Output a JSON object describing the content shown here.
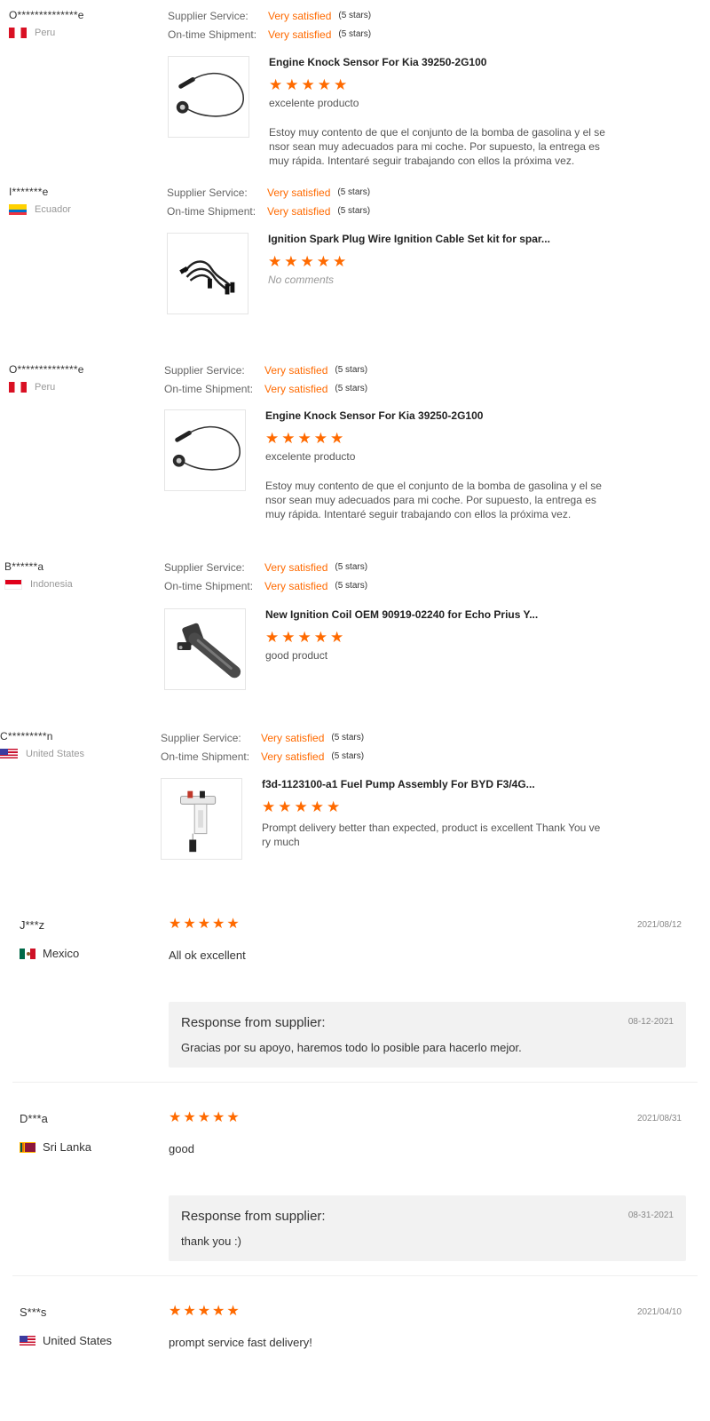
{
  "labels": {
    "supplier_service": "Supplier Service:",
    "ontime_shipment": "On-time Shipment:",
    "response_from_supplier": "Response from supplier:"
  },
  "product_reviews": [
    {
      "user": "O**************e",
      "country": "Peru",
      "supplier_service": "Very satisfied",
      "supplier_service_stars": "(5 stars)",
      "ontime_shipment": "Very satisfied",
      "ontime_shipment_stars": "(5 stars)",
      "product_title": "Engine Knock Sensor For Kia 39250-2G100",
      "product_image": "knock-sensor-image",
      "rating": 5,
      "comment": "excelente producto",
      "detail": "Estoy muy contento de que el conjunto de la bomba de gasolina y el se nsor sean muy adecuados para mi coche. Por supuesto, la entrega es muy rápida. Intentaré seguir trabajando con ellos la próxima vez."
    },
    {
      "user": "I*******e",
      "country": "Ecuador",
      "supplier_service": "Very satisfied",
      "supplier_service_stars": "(5 stars)",
      "ontime_shipment": "Very satisfied",
      "ontime_shipment_stars": "(5 stars)",
      "product_title": "Ignition Spark Plug Wire Ignition Cable Set kit for spar...",
      "product_image": "spark-plug-wire-image",
      "rating": 5,
      "comment": "No comments",
      "detail": ""
    },
    {
      "user": "O**************e",
      "country": "Peru",
      "supplier_service": "Very satisfied",
      "supplier_service_stars": "(5 stars)",
      "ontime_shipment": "Very satisfied",
      "ontime_shipment_stars": "(5 stars)",
      "product_title": "Engine Knock Sensor For Kia 39250-2G100",
      "product_image": "knock-sensor-image",
      "rating": 5,
      "comment": "excelente producto",
      "detail": "Estoy muy contento de que el conjunto de la bomba de gasolina y el se nsor sean muy adecuados para mi coche. Por supuesto, la entrega es muy rápida. Intentaré seguir trabajando con ellos la próxima vez."
    },
    {
      "user": "B******a",
      "country": "Indonesia",
      "supplier_service": "Very satisfied",
      "supplier_service_stars": "(5 stars)",
      "ontime_shipment": "Very satisfied",
      "ontime_shipment_stars": "(5 stars)",
      "product_title": "New Ignition Coil OEM 90919-02240 for Echo Prius Y...",
      "product_image": "ignition-coil-image",
      "rating": 5,
      "comment": "good product",
      "detail": ""
    },
    {
      "user": "C*********n",
      "country": "United States",
      "supplier_service": "Very satisfied",
      "supplier_service_stars": "(5 stars)",
      "ontime_shipment": "Very satisfied",
      "ontime_shipment_stars": "(5 stars)",
      "product_title": "f3d-1123100-a1 Fuel Pump Assembly For BYD F3/4G...",
      "product_image": "fuel-pump-image",
      "rating": 5,
      "comment": "Prompt delivery better than expected, product is excellent Thank You ve ry much",
      "detail": ""
    }
  ],
  "feedback": [
    {
      "user": "J***z",
      "country": "Mexico",
      "rating": 5,
      "date": "2021/08/12",
      "text": "All ok excellent",
      "response_date": "08-12-2021",
      "response_text": "Gracias por su apoyo, haremos todo lo posible para hacerlo mejor."
    },
    {
      "user": "D***a",
      "country": "Sri Lanka",
      "rating": 5,
      "date": "2021/08/31",
      "text": "good",
      "response_date": "08-31-2021",
      "response_text": "thank you :)"
    },
    {
      "user": "S***s",
      "country": "United States",
      "rating": 5,
      "date": "2021/04/10",
      "text": "prompt service fast delivery!"
    }
  ],
  "colors": {
    "accent": "#ff6a00",
    "muted": "#999999",
    "response_bg": "#f2f2f2"
  }
}
